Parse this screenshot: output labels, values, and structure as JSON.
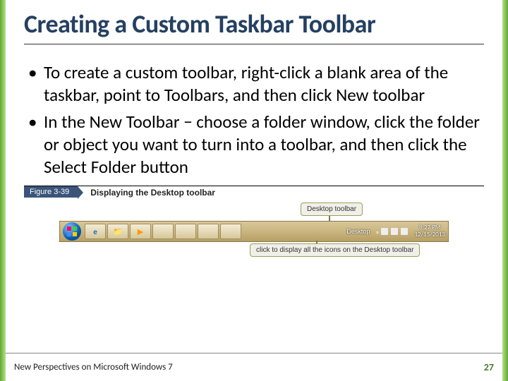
{
  "title": "Creating a Custom Taskbar Toolbar",
  "bullets": [
    "To create a custom toolbar, right-click a blank area of the taskbar, point to Toolbars, and then click New toolbar",
    "In the New Toolbar − choose a folder window, click the folder or object you want to turn into a toolbar, and then click the Select Folder button"
  ],
  "figure": {
    "tab": "Figure 3-39",
    "caption": "Displaying the Desktop toolbar",
    "callout_top": "Desktop toolbar",
    "callout_bottom": "click to display all the icons on the Desktop toolbar",
    "desktop_label": "Desktop",
    "clock_time": "8:27 PM",
    "clock_date": "12/15/2013"
  },
  "footer": {
    "left": "New Perspectives on Microsoft Windows 7",
    "page": "27"
  }
}
